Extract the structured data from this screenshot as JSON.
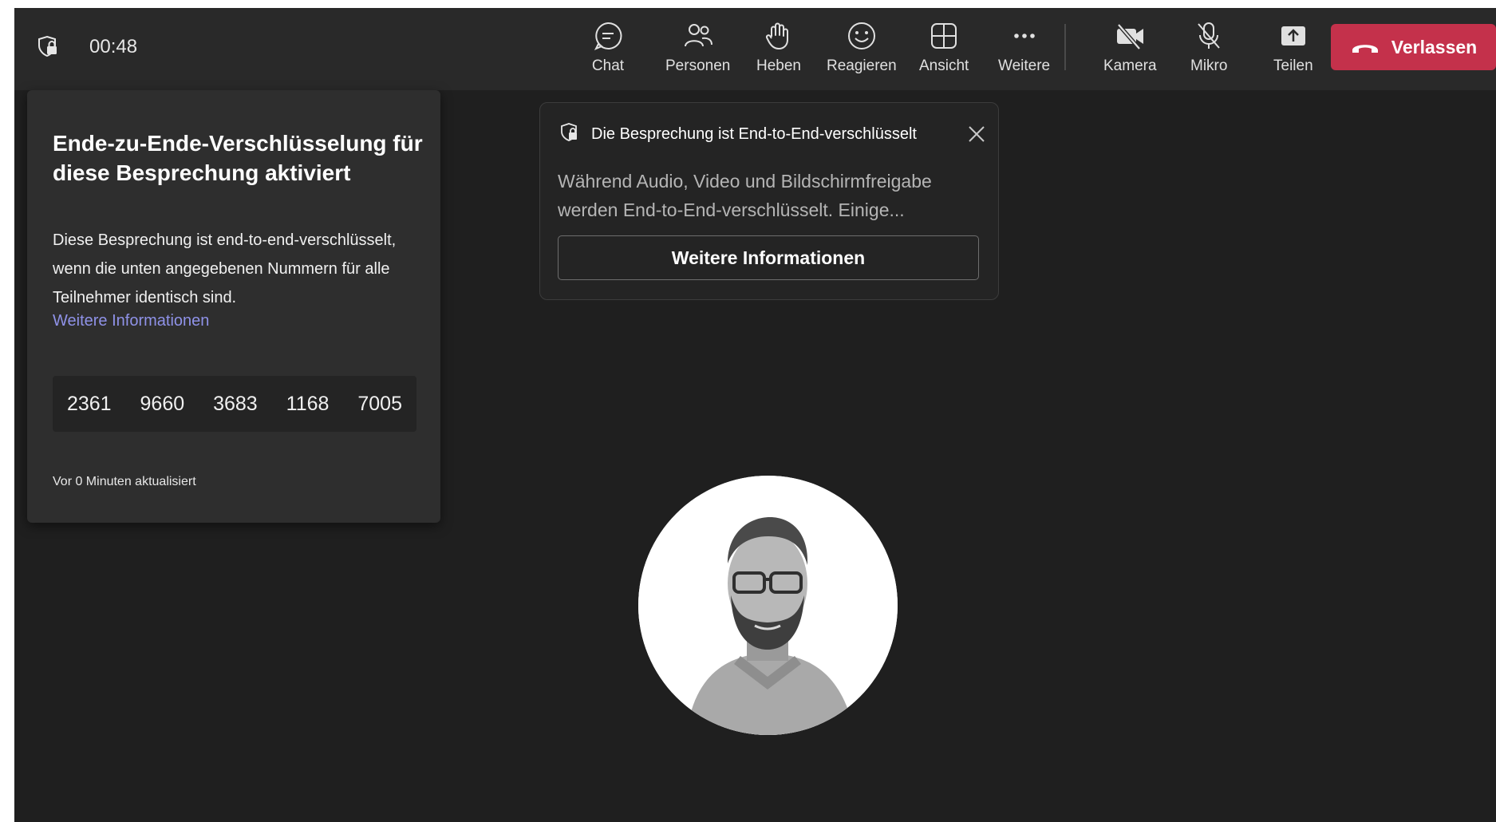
{
  "call": {
    "timer": "00:48"
  },
  "toolbar": {
    "buttons": [
      {
        "label": "Chat",
        "icon": "chat-icon"
      },
      {
        "label": "Personen",
        "icon": "people-icon"
      },
      {
        "label": "Heben",
        "icon": "raise-hand-icon"
      },
      {
        "label": "Reagieren",
        "icon": "smiley-icon"
      },
      {
        "label": "Ansicht",
        "icon": "grid-view-icon"
      },
      {
        "label": "Weitere",
        "icon": "more-icon"
      },
      {
        "label": "Kamera",
        "icon": "camera-off-icon"
      },
      {
        "label": "Mikro",
        "icon": "mic-off-icon"
      },
      {
        "label": "Teilen",
        "icon": "share-icon"
      }
    ],
    "leave_label": "Verlassen"
  },
  "e2e_panel": {
    "title": "Ende-zu-Ende-Verschlüsselung für diese Besprechung aktiviert",
    "body": "Diese Besprechung ist end-to-end-verschlüsselt, wenn die unten angegebenen Nummern für alle Teilnehmer identisch sind.",
    "link": "Weitere Informationen",
    "codes": [
      "2361",
      "9660",
      "3683",
      "1168",
      "7005"
    ],
    "updated": "Vor 0 Minuten aktualisiert"
  },
  "toast": {
    "title": "Die Besprechung ist End-to-End-verschlüsselt",
    "text": "Während Audio, Video und Bildschirmfreigabe werden End-to-End-verschlüsselt. Einige...",
    "button": "Weitere Informationen"
  },
  "colors": {
    "background": "#1f1f1f",
    "topbar": "#292929",
    "leave": "#c4314b",
    "link": "#8f92e8"
  }
}
